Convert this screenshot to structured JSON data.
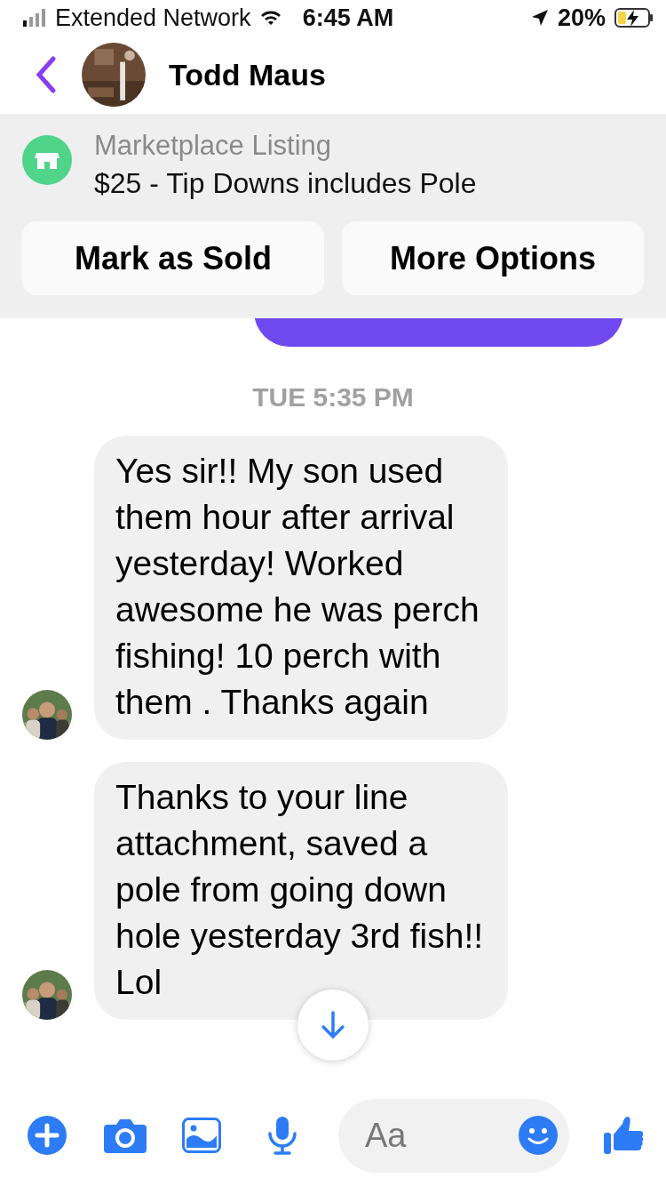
{
  "status_bar": {
    "carrier": "Extended Network",
    "time": "6:45 AM",
    "battery": "20%"
  },
  "header": {
    "name": "Todd Maus"
  },
  "listing": {
    "label": "Marketplace Listing",
    "title": "$25 - Tip Downs includes Pole",
    "buttons": [
      "Mark as Sold",
      "More Options"
    ]
  },
  "messages": [
    {
      "kind": "outgoing"
    },
    {
      "kind": "timestamp",
      "text": "TUE 5:35 PM"
    },
    {
      "kind": "incoming",
      "text": "Yes sir!! My son used them hour after arrival yesterday! Worked awesome he was perch fishing! 10 perch with them . Thanks again"
    },
    {
      "kind": "incoming",
      "text": "Thanks to your line attachment, saved a pole from going down hole yesterday 3rd fish!! Lol"
    }
  ],
  "composer": {
    "placeholder": "Aa"
  }
}
